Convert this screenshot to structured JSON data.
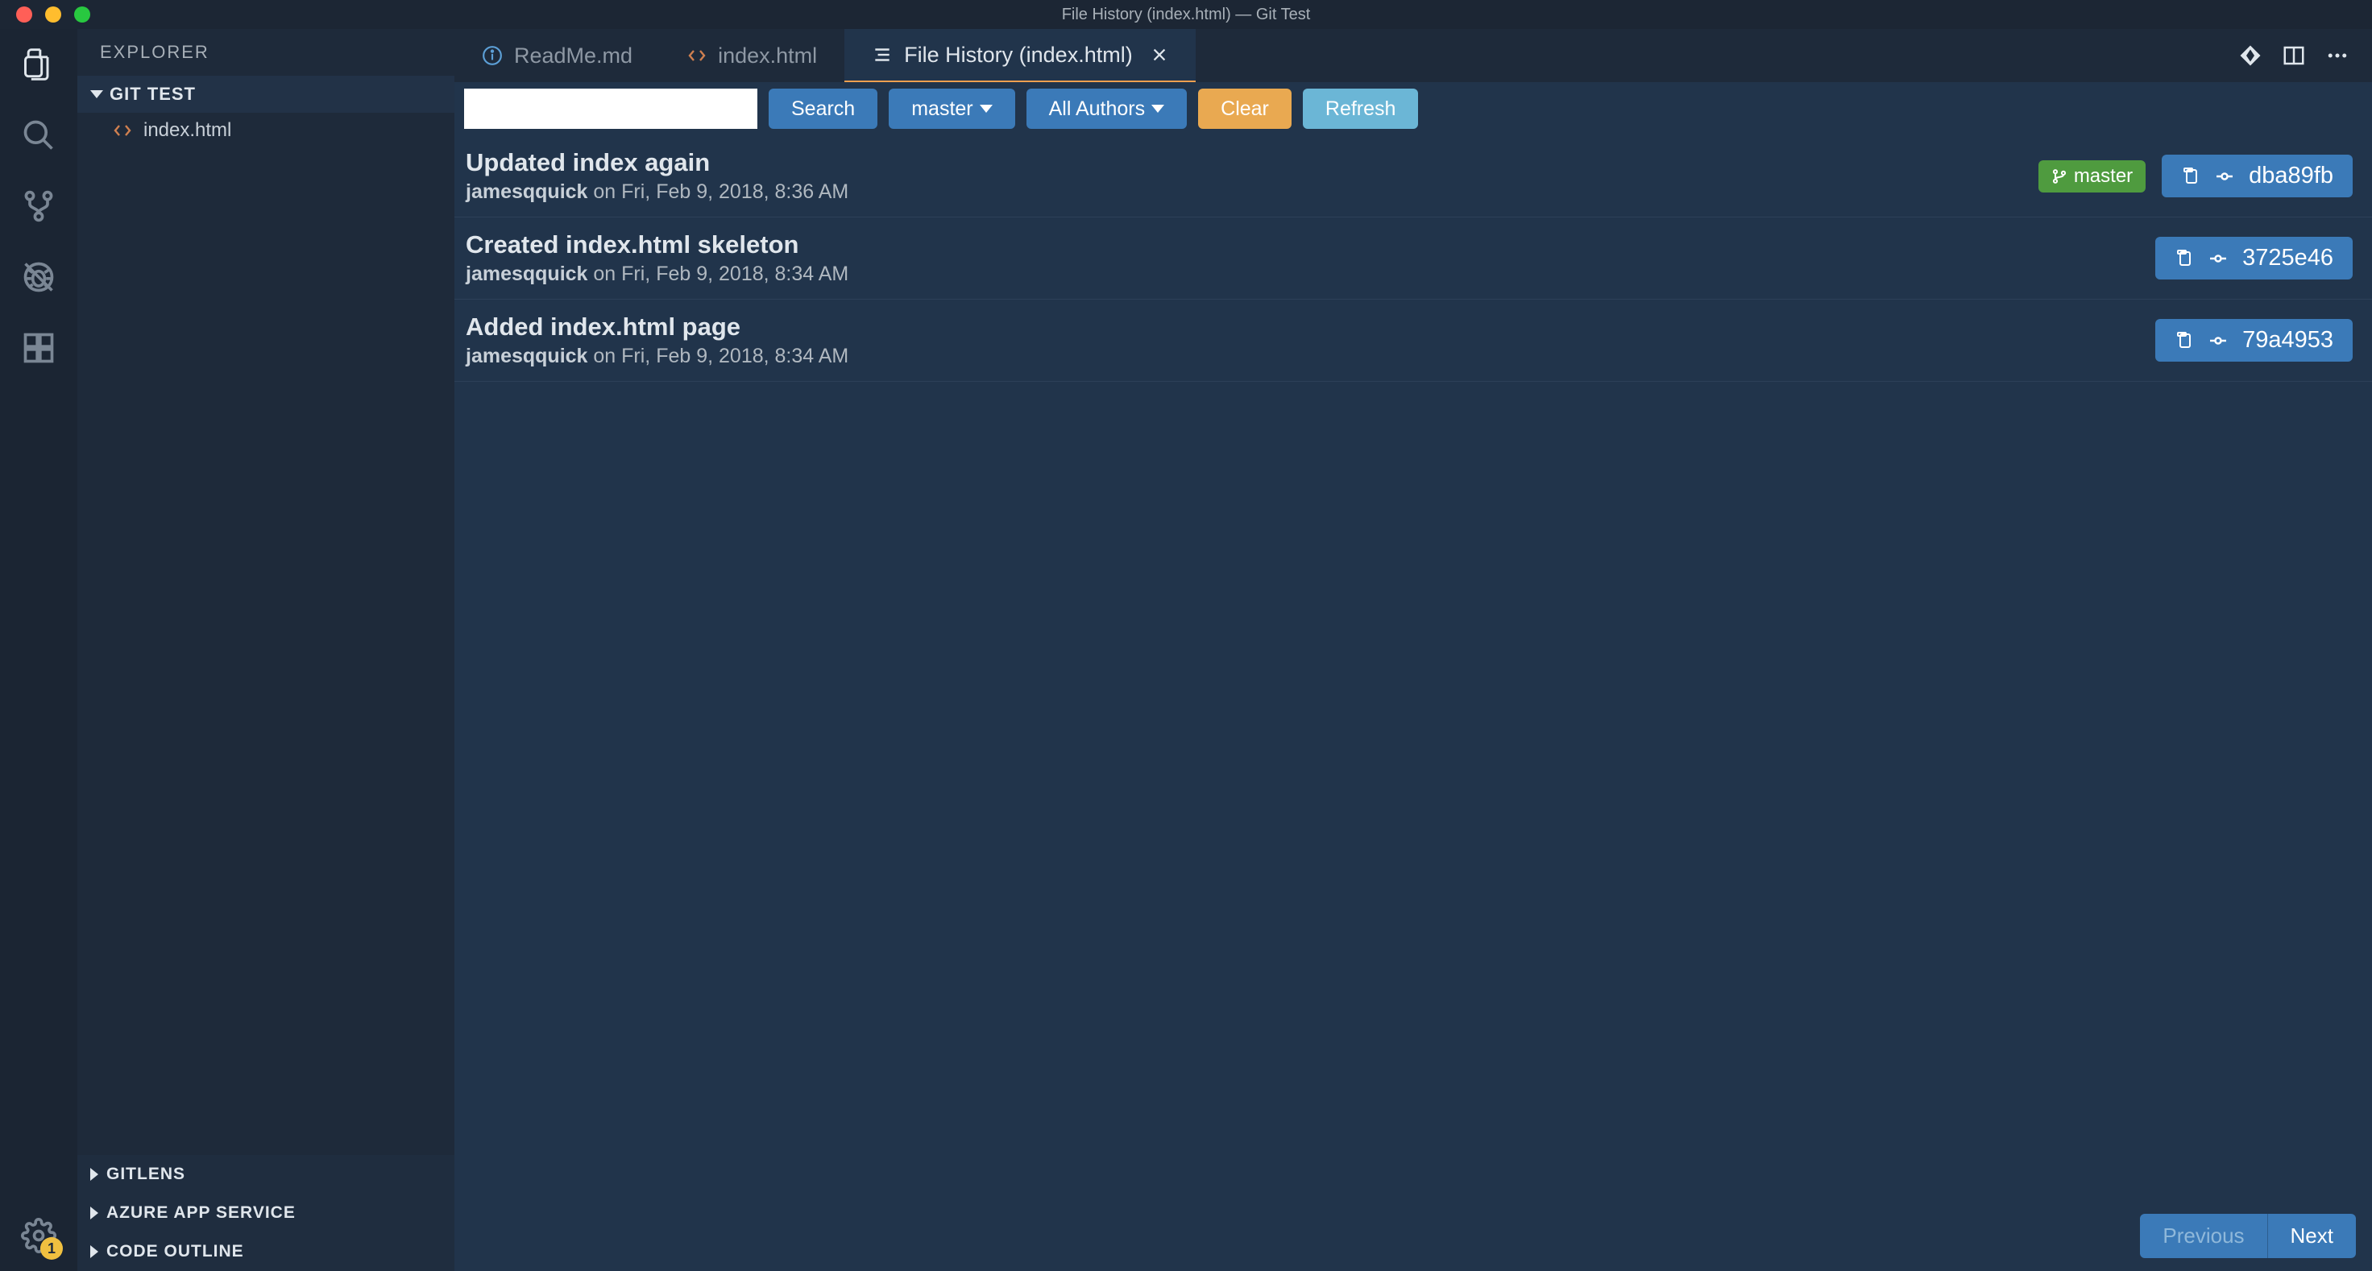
{
  "titlebar": {
    "text": "File History (index.html) — Git Test"
  },
  "activity_bar": {
    "badge_count": "1"
  },
  "sidebar": {
    "header": "EXPLORER",
    "section_title": "GIT TEST",
    "items": [
      {
        "label": "index.html",
        "icon": "code"
      }
    ],
    "bottom_sections": [
      {
        "label": "GITLENS"
      },
      {
        "label": "AZURE APP SERVICE"
      },
      {
        "label": "CODE OUTLINE"
      }
    ]
  },
  "tabs": [
    {
      "label": "ReadMe.md",
      "icon": "info",
      "active": false
    },
    {
      "label": "index.html",
      "icon": "code",
      "active": false
    },
    {
      "label": "File History (index.html)",
      "icon": "list",
      "active": true,
      "closable": true
    }
  ],
  "toolbar": {
    "search_placeholder": "",
    "search_btn": "Search",
    "branch_btn": "master",
    "authors_btn": "All Authors",
    "clear_btn": "Clear",
    "refresh_btn": "Refresh"
  },
  "commits": [
    {
      "title": "Updated index again",
      "author": "jamesqquick",
      "date": "on Fri, Feb 9, 2018, 8:36 AM",
      "branch": "master",
      "hash": "dba89fb"
    },
    {
      "title": "Created index.html skeleton",
      "author": "jamesqquick",
      "date": "on Fri, Feb 9, 2018, 8:34 AM",
      "hash": "3725e46"
    },
    {
      "title": "Added index.html page",
      "author": "jamesqquick",
      "date": "on Fri, Feb 9, 2018, 8:34 AM",
      "hash": "79a4953"
    }
  ],
  "pager": {
    "previous": "Previous",
    "next": "Next"
  }
}
